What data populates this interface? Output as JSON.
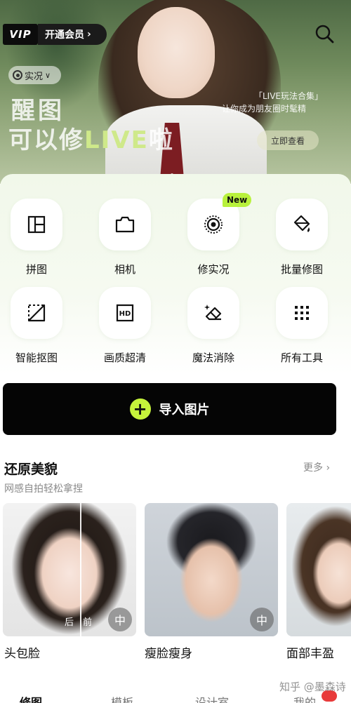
{
  "hero": {
    "vip_badge": "VIP",
    "vip_open": "开通会员",
    "live_chip": "实况",
    "title_line1": "醒图",
    "title_line2_prefix": "可以修",
    "title_line2_live": "LIVE",
    "title_line2_suffix": "啦",
    "sub_line1": "「LIVE玩法合集」",
    "sub_line2": "让你成为朋友圈时髦精",
    "view_button": "立即查看"
  },
  "tools": [
    {
      "label": "拼图",
      "icon": "collage-icon"
    },
    {
      "label": "相机",
      "icon": "camera-icon"
    },
    {
      "label": "修实况",
      "icon": "live-photo-icon",
      "badge": "New"
    },
    {
      "label": "批量修图",
      "icon": "batch-edit-icon"
    },
    {
      "label": "智能抠图",
      "icon": "cutout-icon"
    },
    {
      "label": "画质超清",
      "icon": "hd-icon"
    },
    {
      "label": "魔法消除",
      "icon": "eraser-icon"
    },
    {
      "label": "所有工具",
      "icon": "grid-icon"
    }
  ],
  "import_button": "导入图片",
  "section": {
    "title": "还原美貌",
    "subtitle": "网感自拍轻松拿捏",
    "more": "更多",
    "cards": [
      {
        "title": "头包脸",
        "after": "后",
        "before": "前",
        "compare": "中"
      },
      {
        "title": "瘦脸瘦身",
        "compare": "中"
      },
      {
        "title": "面部丰盈"
      }
    ]
  },
  "nav": {
    "tabs": [
      "修图",
      "模板",
      "设计室",
      "我的"
    ],
    "active": 0
  },
  "watermark": "知乎 @墨森诗",
  "colors": {
    "accent": "#c6f33b",
    "new_badge": "#b8f13c",
    "import_bg": "#050505"
  }
}
